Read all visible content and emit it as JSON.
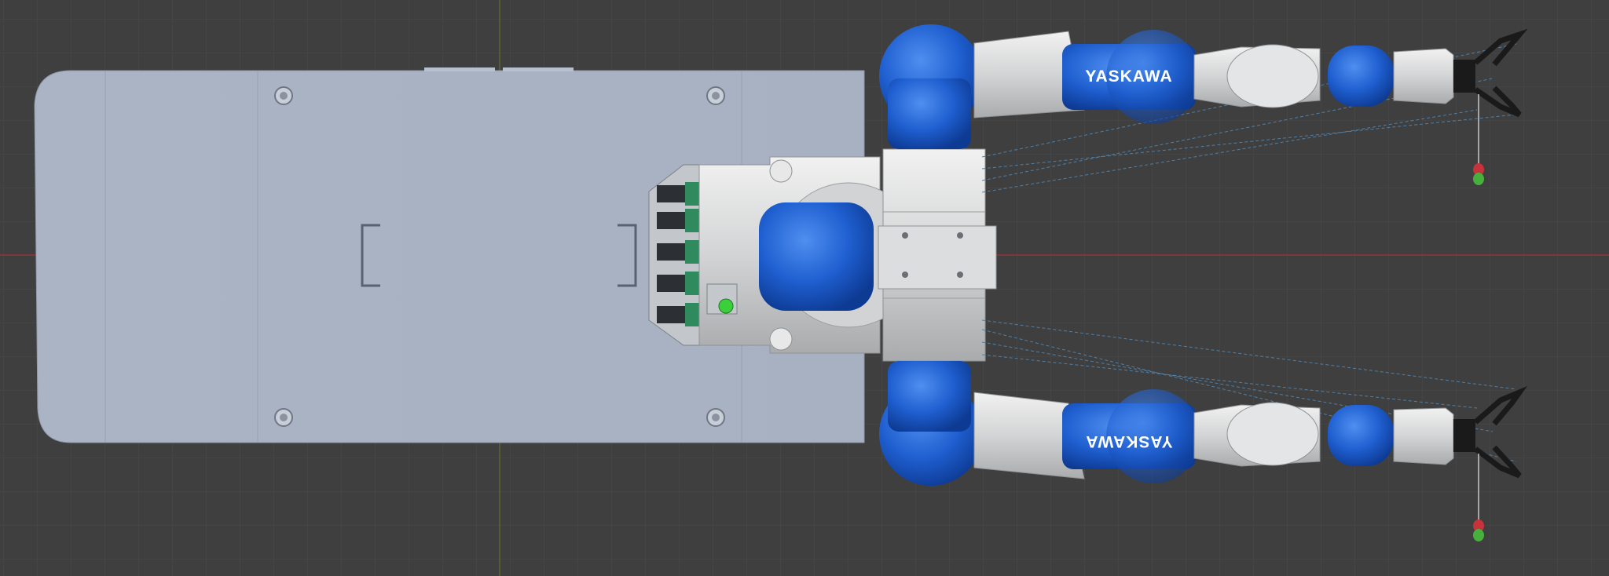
{
  "viewport": {
    "background": "#3f3f3f",
    "grid_color": "#4a4a4a",
    "axis_x_color": "#a0323a",
    "axis_y_color": "#6a7a2e"
  },
  "robot": {
    "brand_top": "YASKAWA",
    "brand_bottom": "YASKAWA",
    "joint_color": "#1f5fd0",
    "body_color": "#d8d9da",
    "base_color": "#a9b3c3",
    "indicator_color": "#3ccf3c",
    "marker_top_color": "#c8323c",
    "marker_bottom_color": "#47b03d",
    "gripper_color": "#1a1a1a"
  },
  "icons": [
    "grid-plane",
    "robot-base",
    "robot-arm",
    "gripper-icon",
    "target-marker-icon"
  ]
}
